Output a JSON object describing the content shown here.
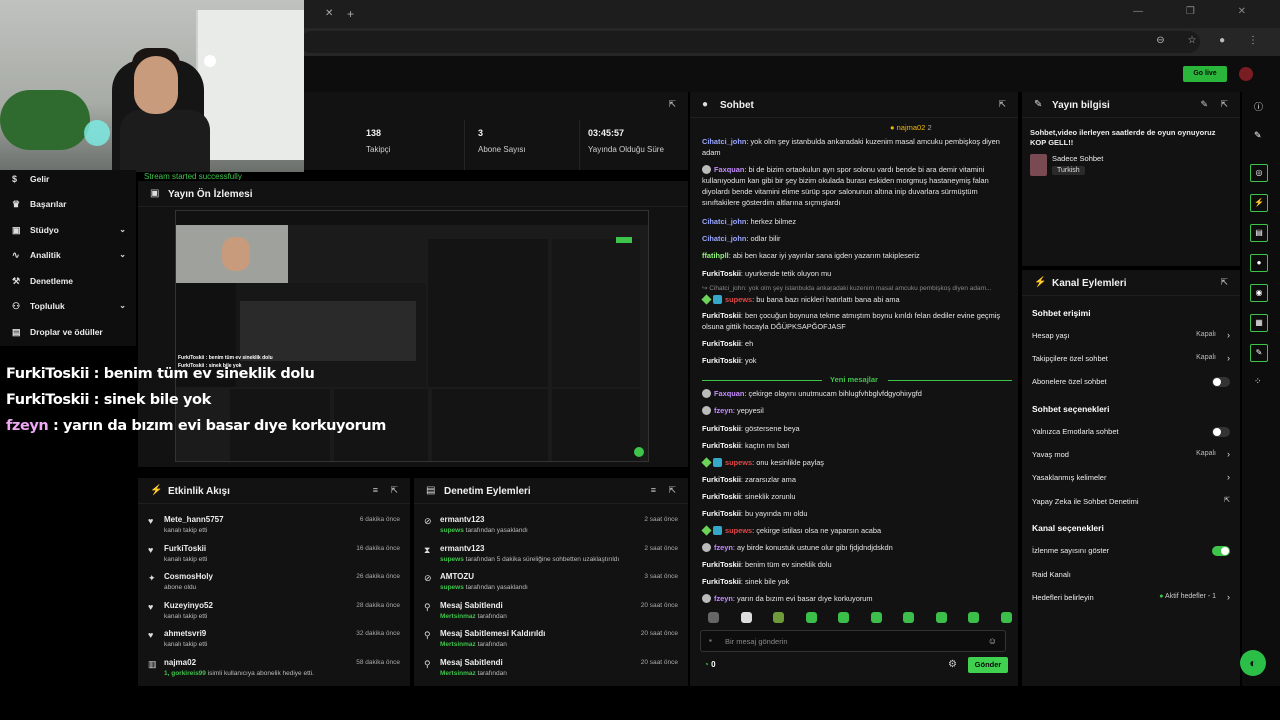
{
  "header": {
    "go_live_label": "Go live"
  },
  "stats": [
    {
      "value": "138",
      "label": "Takipçi"
    },
    {
      "value": "3",
      "label": "Abone Sayısı"
    },
    {
      "value": "03:45:57",
      "label": "Yayında Olduğu Süre"
    }
  ],
  "toast": "Stream started successfully",
  "nav": {
    "items": [
      {
        "icon": "$",
        "label": "Gelir",
        "chevron": ""
      },
      {
        "icon": "♛",
        "label": "Başarılar",
        "chevron": ""
      },
      {
        "icon": "▣",
        "label": "Stüdyo",
        "chevron": "⌄"
      },
      {
        "icon": "∿",
        "label": "Analitik",
        "chevron": "⌄"
      },
      {
        "icon": "⚒",
        "label": "Denetleme",
        "chevron": ""
      },
      {
        "icon": "⚇",
        "label": "Topluluk",
        "chevron": "⌄"
      },
      {
        "icon": "▤",
        "label": "Droplar ve ödüller",
        "chevron": ""
      }
    ]
  },
  "overlay_chat": [
    {
      "user": "FurkiToskii",
      "text": " : benim tüm ev sineklik dolu"
    },
    {
      "user": "FurkiToskii",
      "text": " : sinek bile yok"
    },
    {
      "user": "fzeyn",
      "text": " : yarın da bızım evi basar dıye korkuyorum"
    }
  ],
  "preview": {
    "title": "Yayın Ön İzlemesi",
    "caption1": "FurkiToskii : benim tüm ev sineklik dolu",
    "caption2": "FurkiToskii : sinek bile yok"
  },
  "events": {
    "title": "Etkinlik Akışı",
    "items": [
      {
        "icon": "♥",
        "name": "Mete_hann5757",
        "sub": "kanalı takip etti",
        "sub_highlight": "",
        "time": "6 dakika önce"
      },
      {
        "icon": "♥",
        "name": "FurkiToskii",
        "sub": "kanalı takip etti",
        "sub_highlight": "",
        "time": "16 dakika önce"
      },
      {
        "icon": "✦",
        "name": "CosmosHoly",
        "sub": "abone oldu",
        "sub_highlight": "",
        "time": "26 dakika önce"
      },
      {
        "icon": "♥",
        "name": "Kuzeyinyo52",
        "sub": "kanalı takip etti",
        "sub_highlight": "",
        "time": "28 dakika önce"
      },
      {
        "icon": "♥",
        "name": "ahmetsvri9",
        "sub": "kanalı takip etti",
        "sub_highlight": "",
        "time": "32 dakika önce"
      },
      {
        "icon": "▥",
        "name": "najma02",
        "sub": " isimli kullanıcıya abonelik hediye etti.",
        "sub_highlight": "1, gorkireis99",
        "time": "58 dakika önce"
      }
    ]
  },
  "mod_actions": {
    "title": "Denetim Eylemleri",
    "items": [
      {
        "icon": "⊘",
        "name": "ermantv123",
        "actor": "supews",
        "sub": " tarafından yasaklandı",
        "time": "2 saat önce"
      },
      {
        "icon": "⧗",
        "name": "ermantv123",
        "actor": "supews",
        "sub": " tarafından 5 dakika süreliğine sohbetten uzaklaştırıldı",
        "time": "2 saat önce"
      },
      {
        "icon": "⊘",
        "name": "AMTOZU",
        "actor": "supews",
        "sub": " tarafından yasaklandı",
        "time": "3 saat önce"
      },
      {
        "icon": "⚲",
        "name": "Mesaj Sabitlendi",
        "actor": "Mertsinmaz",
        "sub": " tarafından",
        "time": "20 saat önce"
      },
      {
        "icon": "⚲",
        "name": "Mesaj Sabitlemesi Kaldırıldı",
        "actor": "Mertsinmaz",
        "sub": " tarafından",
        "time": "20 saat önce"
      },
      {
        "icon": "⚲",
        "name": "Mesaj Sabitlendi",
        "actor": "Mertsinmaz",
        "sub": " tarafından",
        "time": "20 saat önce"
      }
    ]
  },
  "chat": {
    "title": "Sohbet",
    "pinned_user": "najma02",
    "pinned_count": "2",
    "divider": "Yeni mesajlar",
    "input_placeholder": "Bir mesaj gönderin",
    "points": "0",
    "send_label": "Gönder",
    "messages": [
      {
        "badge": "",
        "user": "Cihatci_john",
        "color": "u-blue",
        "text": ": yok olm şey istanbulda ankaradaki kuzenim masal amcuku pembişkoş diyen adam"
      },
      {
        "badge": "gray",
        "user": "Faxquan",
        "color": "u-purple",
        "text": ": bi de bizim ortaokulun ayrı spor solonu vardı bende bi ara demir vitamini kullanıyodum kan gibi bir şey bizim okulada burası eskiden morgmuş hastaneymiş falan diyolardı bende vitamini elime sürüp spor salonunun altına inip duvarlara sürmüştüm sınıftakilere gösterdim altlarına sıçmışlardı"
      },
      {
        "badge": "",
        "user": "Cihatci_john",
        "color": "u-blue",
        "text": ": herkez bilmez"
      },
      {
        "badge": "",
        "user": "Cihatci_john",
        "color": "u-blue",
        "text": ": odlar bilir"
      },
      {
        "badge": "",
        "user": "ffatihpll",
        "color": "u-green",
        "text": ": abi ben kacar iyi yayınlar sana igden yazarım takipleseriz"
      },
      {
        "badge": "",
        "user": "FurkiToskii",
        "color": "u-white",
        "text": ": uyurkende tetik oluyon mu"
      },
      {
        "badge": "",
        "user": "",
        "color": "u-white",
        "text": "↪ Cihatci_john: yok olm şey istanbulda ankaradaki kuzenim masal amcuku pembişkoş diyen adam..."
      },
      {
        "badge": "gb",
        "user": "supews",
        "color": "u-red",
        "text": ": bu bana bazı nickleri hatırlattı bana abi ama"
      },
      {
        "badge": "",
        "user": "FurkiToskii",
        "color": "u-white",
        "text": ": ben çocuğun boynuna tekme atmıştım boynu kırıldı felan dediler evine geçmiş olsuna gittik hocayla DĞÜPKSAPĞOFJASF"
      },
      {
        "badge": "",
        "user": "FurkiToskii",
        "color": "u-white",
        "text": ": eh"
      },
      {
        "badge": "",
        "user": "FurkiToskii",
        "color": "u-white",
        "text": ": yok"
      },
      {
        "badge": "gray",
        "user": "Faxquan",
        "color": "u-purple",
        "text": ": çekirge olayını unutmucam bihlugfvhbglvfdgyohiıygfd"
      },
      {
        "badge": "gray",
        "user": "fzeyn",
        "color": "u-purple",
        "text": ": yepyesil"
      },
      {
        "badge": "",
        "user": "FurkiToskii",
        "color": "u-white",
        "text": ": göstersene beya"
      },
      {
        "badge": "",
        "user": "FurkiToskii",
        "color": "u-white",
        "text": ": kaçtın mı bari"
      },
      {
        "badge": "gb",
        "user": "supews",
        "color": "u-red",
        "text": ": onu kesinlikle paylaş"
      },
      {
        "badge": "",
        "user": "FurkiToskii",
        "color": "u-white",
        "text": ": zararsızlar ama"
      },
      {
        "badge": "",
        "user": "FurkiToskii",
        "color": "u-white",
        "text": ": sineklik zorunlu"
      },
      {
        "badge": "",
        "user": "FurkiToskii",
        "color": "u-white",
        "text": ": bu yayında mı oldu"
      },
      {
        "badge": "gb",
        "user": "supews",
        "color": "u-red",
        "text": ": çekirge istilası olsa ne yaparsın acaba"
      },
      {
        "badge": "gray",
        "user": "fzeyn",
        "color": "u-purple",
        "text": ": ay birde konustuk ustune olur gibı fjdjdndjdskdn"
      },
      {
        "badge": "",
        "user": "FurkiToskii",
        "color": "u-white",
        "text": ": benim tüm ev sineklik dolu"
      },
      {
        "badge": "",
        "user": "FurkiToskii",
        "color": "u-white",
        "text": ": sinek bile yok"
      },
      {
        "badge": "gray",
        "user": "fzeyn",
        "color": "u-purple",
        "text": ": yarın da bızım evi basar dıye korkuyorum"
      }
    ]
  },
  "stream_info": {
    "title": "Yayın bilgisi",
    "description": "Sohbet,video ilerleyen saatlerde de oyun oynuyoruz KOP GELL!!",
    "category": "Sadece Sohbet",
    "language": "Turkish"
  },
  "channel_actions": {
    "title": "Kanal Eylemleri",
    "chat_access_head": "Sohbet erişimi",
    "chat_options_head": "Sohbet seçenekleri",
    "channel_options_head": "Kanal seçenekleri",
    "account_age": {
      "label": "Hesap yaşı",
      "value": "Kapalı"
    },
    "followers_only": {
      "label": "Takipçilere özel sohbet",
      "value": "Kapalı"
    },
    "subs_only": {
      "label": "Abonelere özel sohbet"
    },
    "emotes_only": {
      "label": "Yalnızca Emotlarla sohbet"
    },
    "slow_mode": {
      "label": "Yavaş mod",
      "value": "Kapalı"
    },
    "banned_words": {
      "label": "Yasaklanmış kelimeler"
    },
    "ai_moderation": {
      "label": "Yapay Zeka ile Sohbet Denetimi"
    },
    "show_viewers": {
      "label": "İzlenme sayısını göster"
    },
    "raid": {
      "label": "Raid Kanalı"
    },
    "goals": {
      "label": "Hedefleri belirleyin",
      "value": "Aktif hedefler - 1"
    }
  }
}
